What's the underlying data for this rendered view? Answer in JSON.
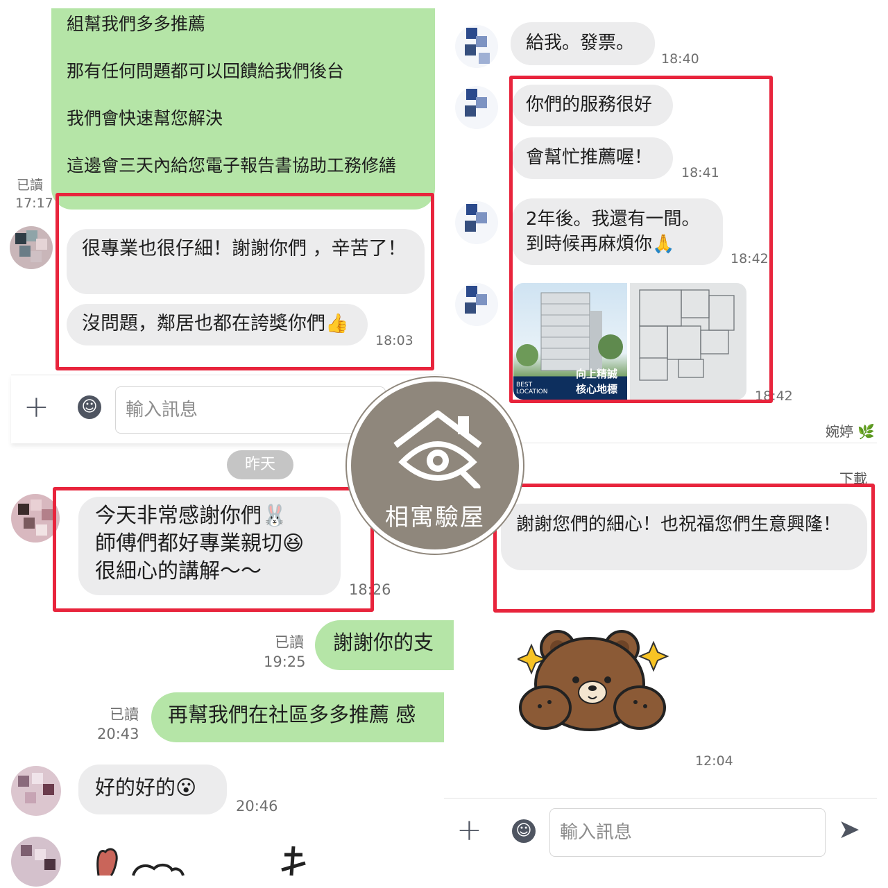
{
  "left_top": {
    "green_message": "組幫我們多多推薦\n\n那有任何問題都可以回饋給我們後台\n\n我們會快速幫您解決\n\n這邊會三天內給您電子報告書協助工務修繕",
    "read_label": "已讀",
    "read_time": "17:17",
    "msg1": "很專業也很仔細！謝謝你們 ，辛苦了！",
    "msg2": "沒問題，鄰居也都在誇獎你們👍",
    "msg2_time": "18:03"
  },
  "left_input": {
    "plus": "+",
    "emoji": "☺",
    "placeholder": "輸入訊息"
  },
  "left_bottom": {
    "date_pill": "昨天",
    "msg1": "今天非常感謝你們🐰\n師傅們都好專業親切😆\n很細心的講解～～",
    "msg1_time": "18:26",
    "reply1": "謝謝你的支",
    "reply1_read": "已讀",
    "reply1_time": "19:25",
    "reply2": "再幫我們在社區多多推薦 感",
    "reply2_read": "已讀",
    "reply2_time": "20:43",
    "msg2": "好的好的😮",
    "msg2_time": "20:46"
  },
  "right_top": {
    "msg0": "給我。發票。",
    "msg0_time": "18:40",
    "msg1": "你們的服務很好",
    "msg2": "會幫忙推薦喔！",
    "msg2_time": "18:41",
    "msg3": "2年後。我還有一間。\n到時候再麻煩你🙏",
    "msg3_time": "18:42",
    "ad_line1": "向上精誠",
    "ad_line2": "核心地標",
    "ad_small1": "BEST",
    "ad_small2": "LOCATION",
    "img_time": "18:42",
    "sender_name": "婉婷",
    "sender_icon": "🌿"
  },
  "right_bottom": {
    "download": "下載",
    "msg1": "謝謝您們的細心！也祝福您們生意興隆！",
    "sticker_time": "12:04"
  },
  "right_input": {
    "plus": "+",
    "emoji": "☺",
    "placeholder": "輸入訊息",
    "send_icon": "➤"
  },
  "watermark": {
    "label": "相寓驗屋"
  },
  "colors": {
    "highlight_red": "#e8243c",
    "my_bubble": "#b5e5a7",
    "their_bubble": "#ececed",
    "watermark": "#8f877c"
  }
}
